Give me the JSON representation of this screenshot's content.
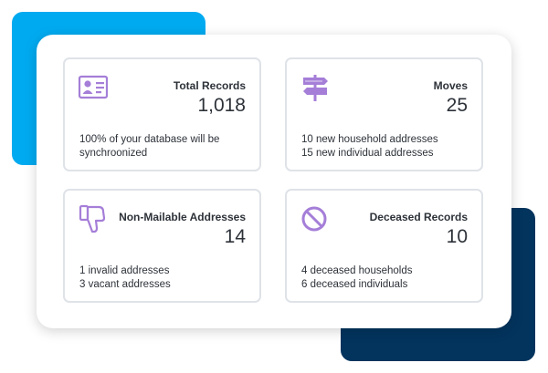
{
  "colors": {
    "accent_blue": "#00aaf0",
    "accent_navy": "#03345e",
    "icon_purple": "#a57ed8",
    "card_border": "#dfe3e8",
    "text": "#2d3239"
  },
  "cards": [
    {
      "icon": "id-card-icon",
      "title": "Total Records",
      "value": "1,018",
      "lines": [
        "100% of your database will be",
        "synchroonized"
      ]
    },
    {
      "icon": "signpost-icon",
      "title": "Moves",
      "value": "25",
      "lines": [
        "10 new household addresses",
        "15 new individual addresses"
      ]
    },
    {
      "icon": "thumbs-down-icon",
      "title": "Non-Mailable Addresses",
      "value": "14",
      "lines": [
        "1 invalid addresses",
        "3 vacant addresses"
      ]
    },
    {
      "icon": "prohibited-icon",
      "title": "Deceased Records",
      "value": "10",
      "lines": [
        "4 deceased households",
        "6 deceased individuals"
      ]
    }
  ]
}
